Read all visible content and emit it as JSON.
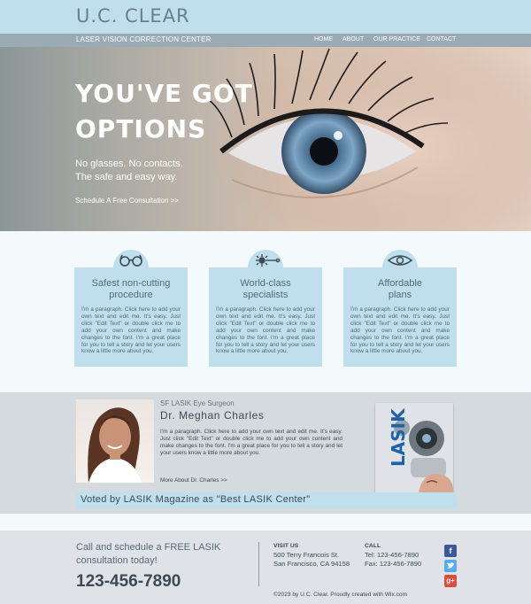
{
  "header": {
    "logo": "U.C. CLEAR",
    "tagline": "LASER VISION CORRECTION CENTER",
    "nav": [
      "HOME",
      "ABOUT",
      "OUR PRACTICE",
      "CONTACT"
    ]
  },
  "hero": {
    "headline_line1": "YOU'VE GOT",
    "headline_line2": "OPTIONS",
    "sub_line1": "No glasses. No contacts.",
    "sub_line2": "The safe and easy way.",
    "cta": "Schedule A Free Consultation >>"
  },
  "features": [
    {
      "title_line1": "Safest non-cutting",
      "title_line2": "procedure",
      "icon": "glasses-icon",
      "body": "I'm a paragraph. Click here to add your own text and edit me. It's easy. Just click \"Edit Text\" or double click me to add your own content and make changes to the font. I'm a great place for you to tell a story and let your users know a little more about you."
    },
    {
      "title_line1": "World-class",
      "title_line2": "specialists",
      "icon": "laser-icon",
      "body": "I'm a paragraph. Click here to add your own text and edit me. It's easy. Just click \"Edit Text\" or double click me to add your own content and make changes to the font. I'm a great place for you to tell a story and let your users know a little more about you."
    },
    {
      "title_line1": "Affordable",
      "title_line2": "plans",
      "icon": "eye-icon",
      "body": "I'm a paragraph. Click here to add your own text and edit me. It's easy. Just click \"Edit Text\" or double click me to add your own content and make changes to the font. I'm a great place for you to tell a story and let your users know a little more about you."
    }
  ],
  "doctor": {
    "role": "SF LASIK Eye Surgeon",
    "name": "Dr. Meghan Charles",
    "bio": "I'm a paragraph. Click here to add your own text and edit me. It's easy. Just click \"Edit Text\" or double click me to add your own content and make changes to the font. I'm a great place for you to tell a story and let your users know a little more about you.",
    "more": "More About Dr. Charles >>",
    "magazine_title": "LASIK",
    "vote": "Voted by LASIK Magazine as \"Best LASIK Center\""
  },
  "footer": {
    "call_line1": "Call and schedule a FREE LASIK",
    "call_line2": "consultation today!",
    "phone": "123-456-7890",
    "visit_label": "VISIT US",
    "address_line1": "500 Terry Francois St.",
    "address_line2": "San Francisco, CA 94158",
    "call_label": "CALL",
    "tel": "Tel: 123-456-7890",
    "fax": "Fax: 123-456-7890",
    "copyright": "©2023 by U.C. Clear. Proudly created with Wix.com"
  },
  "colors": {
    "accent": "#bfdfec",
    "nav_bar": "#9aabb6",
    "text_dark": "#3d4a54",
    "facebook": "#3b5998",
    "twitter": "#55acee",
    "google_plus": "#dd4b39"
  }
}
